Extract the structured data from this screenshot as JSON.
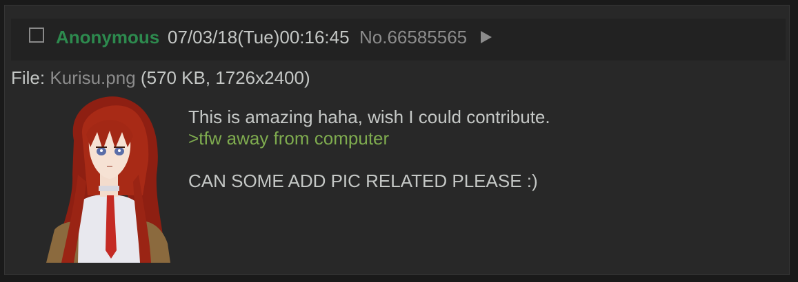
{
  "post": {
    "name": "Anonymous",
    "datetime": "07/03/18(Tue)00:16:45",
    "post_number": "No.66585565",
    "file": {
      "label": "File:",
      "filename": "Kurisu.png",
      "meta": "(570 KB, 1726x2400)"
    },
    "message": {
      "line1": "This is amazing haha, wish I could contribute.",
      "greentext": ">tfw away from computer",
      "line3": "CAN SOME ADD PIC RELATED PLEASE :)"
    },
    "icons": {
      "checkbox": "checkbox-icon",
      "menu": "menu-arrow-icon"
    },
    "colors": {
      "background": "#1a1a1a",
      "post_bg": "#282828",
      "name": "#2d8a4e",
      "greentext": "#7fac4f",
      "text": "#c5c8c6",
      "muted": "#8c8c8c"
    }
  }
}
